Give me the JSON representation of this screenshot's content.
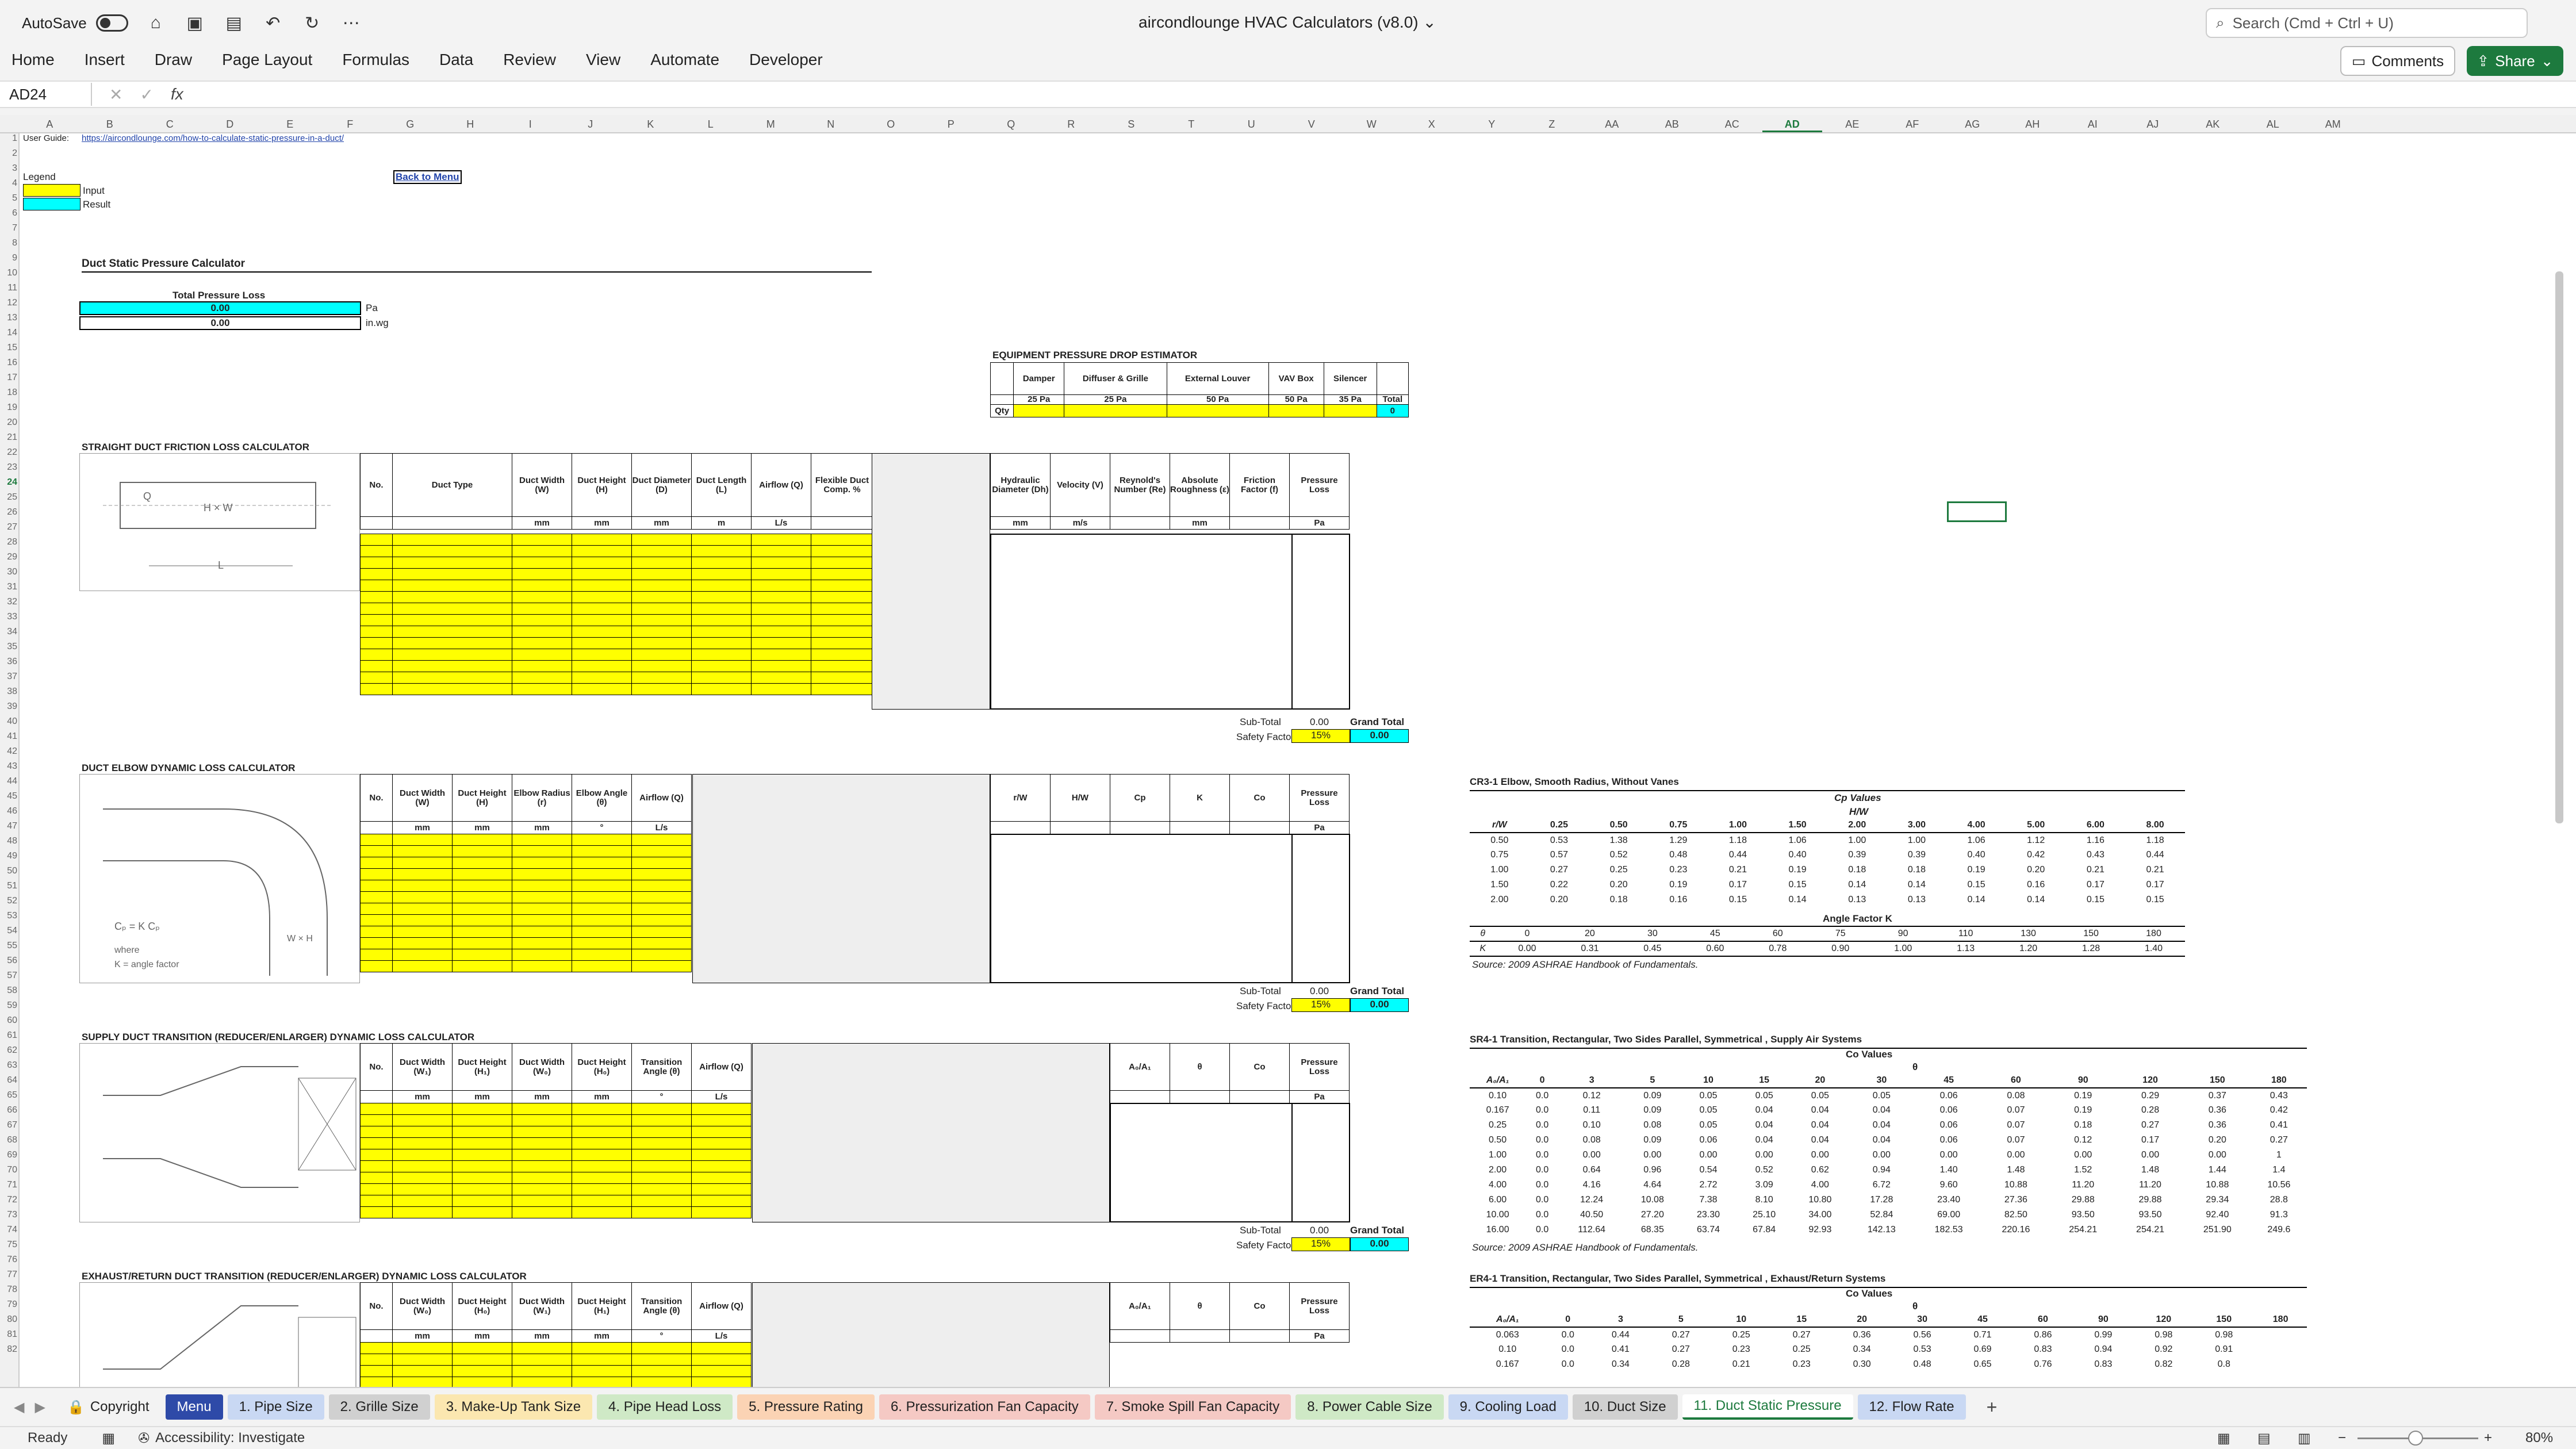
{
  "app": {
    "autosave": "AutoSave",
    "title": "aircondlounge HVAC Calculators (v8.0)",
    "search_placeholder": "Search (Cmd + Ctrl + U)"
  },
  "ribbon": {
    "tabs": [
      "Home",
      "Insert",
      "Draw",
      "Page Layout",
      "Formulas",
      "Data",
      "Review",
      "View",
      "Automate",
      "Developer"
    ],
    "comments": "Comments",
    "share": "Share"
  },
  "formula": {
    "namebox": "AD24",
    "fx": "fx"
  },
  "columns": [
    "A",
    "B",
    "C",
    "D",
    "E",
    "F",
    "G",
    "H",
    "I",
    "J",
    "K",
    "L",
    "M",
    "N",
    "O",
    "P",
    "Q",
    "R",
    "S",
    "T",
    "U",
    "V",
    "W",
    "X",
    "Y",
    "Z",
    "AA",
    "AB",
    "AC",
    "AD",
    "AE",
    "AF",
    "AG",
    "AH",
    "AI",
    "AJ",
    "AK",
    "AL",
    "AM"
  ],
  "sheet": {
    "user_guide_label": "User Guide:",
    "user_guide_url": "https://aircondlounge.com/how-to-calculate-static-pressure-in-a-duct/",
    "legend": "Legend",
    "legend_input": "Input",
    "legend_result": "Result",
    "back_to_menu": "Back to Menu",
    "calc_title": "Duct Static Pressure Calculator",
    "total_loss_label": "Total Pressure Loss",
    "total_pa": "0.00",
    "total_inwg": "0.00",
    "unit_pa": "Pa",
    "unit_inwg": "in.wg",
    "equip": {
      "title": "EQUIPMENT PRESSURE DROP ESTIMATOR",
      "headers": [
        "Damper",
        "Diffuser & Grille",
        "External Louver",
        "VAV Box",
        "Silencer"
      ],
      "values": [
        "25 Pa",
        "25 Pa",
        "50 Pa",
        "50 Pa",
        "35 Pa"
      ],
      "total": "Total",
      "qty": "Qty",
      "total_value": "0"
    },
    "straight": {
      "title": "STRAIGHT DUCT FRICTION LOSS CALCULATOR",
      "headers": [
        "No.",
        "Duct Type",
        "Duct Width (W)",
        "Duct Height (H)",
        "Duct Diameter (D)",
        "Duct Length (L)",
        "Airflow (Q)",
        "Flexible Duct Comp. %"
      ],
      "units": [
        "",
        "",
        "mm",
        "mm",
        "mm",
        "m",
        "L/s",
        ""
      ],
      "right_headers": [
        "Hydraulic Diameter (Dh)",
        "Velocity (V)",
        "Reynold's Number (Re)",
        "Absolute Roughness (ε)",
        "Friction Factor (f)",
        "Pressure Loss"
      ],
      "right_units": [
        "mm",
        "m/s",
        "",
        "mm",
        "",
        "Pa"
      ],
      "subtotal": "0.00",
      "sf": "15%",
      "grand": "0.00"
    },
    "elbow": {
      "title": "DUCT ELBOW DYNAMIC LOSS CALCULATOR",
      "headers": [
        "No.",
        "Duct Width (W)",
        "Duct Height (H)",
        "Elbow Radius (r)",
        "Elbow Angle (θ)",
        "Airflow (Q)"
      ],
      "units": [
        "",
        "mm",
        "mm",
        "mm",
        "°",
        "L/s"
      ],
      "right_headers": [
        "r/W",
        "H/W",
        "Cp",
        "K",
        "Co",
        "Pressure Loss"
      ],
      "right_units": [
        "",
        "",
        "",
        "",
        "",
        "Pa"
      ],
      "subtotal": "0.00",
      "sf": "15%",
      "grand": "0.00"
    },
    "supply": {
      "title": "SUPPLY DUCT TRANSITION (REDUCER/ENLARGER) DYNAMIC LOSS CALCULATOR",
      "headers": [
        "No.",
        "Duct Width (W₁)",
        "Duct Height (H₁)",
        "Duct Width (W₀)",
        "Duct Height (H₀)",
        "Transition Angle (θ)",
        "Airflow (Q)"
      ],
      "units": [
        "",
        "mm",
        "mm",
        "mm",
        "mm",
        "°",
        "L/s"
      ],
      "right_headers": [
        "A₀/A₁",
        "θ",
        "Co",
        "Pressure Loss"
      ],
      "right_units": [
        "",
        "",
        "",
        "Pa"
      ],
      "subtotal": "0.00",
      "sf": "15%",
      "grand": "0.00"
    },
    "exhaust": {
      "title": "EXHAUST/RETURN DUCT TRANSITION (REDUCER/ENLARGER) DYNAMIC LOSS CALCULATOR",
      "headers": [
        "No.",
        "Duct Width (W₀)",
        "Duct Height (H₀)",
        "Duct Width (W₁)",
        "Duct Height (H₁)",
        "Transition Angle (θ)",
        "Airflow (Q)"
      ],
      "units": [
        "",
        "mm",
        "mm",
        "mm",
        "mm",
        "°",
        "L/s"
      ],
      "right_headers": [
        "A₀/A₁",
        "θ",
        "Co",
        "Pressure Loss"
      ],
      "right_units": [
        "",
        "",
        "",
        "Pa"
      ]
    },
    "subtotal_label": "Sub-Total",
    "grand_label": "Grand Total",
    "sf_label": "Safety Factor",
    "diagram_labels": {
      "straight_q": "Q",
      "straight_hw": "H × W",
      "straight_l": "L",
      "elbow_eq": "Cₚ = K Cₚ",
      "elbow_where": "where",
      "elbow_k": "K = angle factor",
      "elbow_wh": "W × H"
    },
    "cr3": {
      "title": "CR3-1 Elbow, Smooth Radius, Without Vanes",
      "cp": "Cp Values",
      "hw": "H/W",
      "rw": "r/W",
      "cols": [
        "0.25",
        "0.50",
        "0.75",
        "1.00",
        "1.50",
        "2.00",
        "3.00",
        "4.00",
        "5.00",
        "6.00",
        "8.00"
      ],
      "rows": [
        [
          "0.50",
          "0.53",
          "1.38",
          "1.29",
          "1.18",
          "1.06",
          "1.00",
          "1.00",
          "1.06",
          "1.12",
          "1.16",
          "1.18"
        ],
        [
          "0.75",
          "0.57",
          "0.52",
          "0.48",
          "0.44",
          "0.40",
          "0.39",
          "0.39",
          "0.40",
          "0.42",
          "0.43",
          "0.44"
        ],
        [
          "1.00",
          "0.27",
          "0.25",
          "0.23",
          "0.21",
          "0.19",
          "0.18",
          "0.18",
          "0.19",
          "0.20",
          "0.21",
          "0.21"
        ],
        [
          "1.50",
          "0.22",
          "0.20",
          "0.19",
          "0.17",
          "0.15",
          "0.14",
          "0.14",
          "0.15",
          "0.16",
          "0.17",
          "0.17"
        ],
        [
          "2.00",
          "0.20",
          "0.18",
          "0.16",
          "0.15",
          "0.14",
          "0.13",
          "0.13",
          "0.14",
          "0.14",
          "0.15",
          "0.15"
        ]
      ],
      "af": "Angle Factor K",
      "theta": [
        "θ",
        "0",
        "20",
        "30",
        "45",
        "60",
        "75",
        "90",
        "110",
        "130",
        "150",
        "180"
      ],
      "k": [
        "K",
        "0.00",
        "0.31",
        "0.45",
        "0.60",
        "0.78",
        "0.90",
        "1.00",
        "1.13",
        "1.20",
        "1.28",
        "1.40"
      ],
      "source": "Source: 2009 ASHRAE Handbook of Fundamentals."
    },
    "sr4": {
      "title": "SR4-1 Transition, Rectangular, Two Sides Parallel, Symmetrical , Supply Air Systems",
      "co": "Co Values",
      "th": "θ",
      "a": "A₀/A₁",
      "cols": [
        "0",
        "3",
        "5",
        "10",
        "15",
        "20",
        "30",
        "45",
        "60",
        "90",
        "120",
        "150",
        "180"
      ],
      "rows": [
        [
          "0.10",
          "0.0",
          "0.12",
          "0.09",
          "0.05",
          "0.05",
          "0.05",
          "0.05",
          "0.06",
          "0.08",
          "0.19",
          "0.29",
          "0.37",
          "0.43"
        ],
        [
          "0.167",
          "0.0",
          "0.11",
          "0.09",
          "0.05",
          "0.04",
          "0.04",
          "0.04",
          "0.06",
          "0.07",
          "0.19",
          "0.28",
          "0.36",
          "0.42"
        ],
        [
          "0.25",
          "0.0",
          "0.10",
          "0.08",
          "0.05",
          "0.04",
          "0.04",
          "0.04",
          "0.06",
          "0.07",
          "0.18",
          "0.27",
          "0.36",
          "0.41"
        ],
        [
          "0.50",
          "0.0",
          "0.08",
          "0.09",
          "0.06",
          "0.04",
          "0.04",
          "0.04",
          "0.06",
          "0.07",
          "0.12",
          "0.17",
          "0.20",
          "0.27"
        ],
        [
          "1.00",
          "0.0",
          "0.00",
          "0.00",
          "0.00",
          "0.00",
          "0.00",
          "0.00",
          "0.00",
          "0.00",
          "0.00",
          "0.00",
          "0.00",
          "1"
        ],
        [
          "2.00",
          "0.0",
          "0.64",
          "0.96",
          "0.54",
          "0.52",
          "0.62",
          "0.94",
          "1.40",
          "1.48",
          "1.52",
          "1.48",
          "1.44",
          "1.4"
        ],
        [
          "4.00",
          "0.0",
          "4.16",
          "4.64",
          "2.72",
          "3.09",
          "4.00",
          "6.72",
          "9.60",
          "10.88",
          "11.20",
          "11.20",
          "10.88",
          "10.56"
        ],
        [
          "6.00",
          "0.0",
          "12.24",
          "10.08",
          "7.38",
          "8.10",
          "10.80",
          "17.28",
          "23.40",
          "27.36",
          "29.88",
          "29.88",
          "29.34",
          "28.8"
        ],
        [
          "10.00",
          "0.0",
          "40.50",
          "27.20",
          "23.30",
          "25.10",
          "34.00",
          "52.84",
          "69.00",
          "82.50",
          "93.50",
          "93.50",
          "92.40",
          "91.3"
        ],
        [
          "16.00",
          "0.0",
          "112.64",
          "68.35",
          "63.74",
          "67.84",
          "92.93",
          "142.13",
          "182.53",
          "220.16",
          "254.21",
          "254.21",
          "251.90",
          "249.6"
        ]
      ],
      "source": "Source: 2009 ASHRAE Handbook of Fundamentals."
    },
    "er4": {
      "title": "ER4-1 Transition, Rectangular, Two Sides Parallel, Symmetrical , Exhaust/Return Systems",
      "co": "Co Values",
      "th": "θ",
      "a": "A₀/A₁",
      "cols": [
        "0",
        "3",
        "5",
        "10",
        "15",
        "20",
        "30",
        "45",
        "60",
        "90",
        "120",
        "150",
        "180"
      ],
      "rows": [
        [
          "0.063",
          "0.0",
          "0.44",
          "0.27",
          "0.25",
          "0.27",
          "0.36",
          "0.56",
          "0.71",
          "0.86",
          "0.99",
          "0.98",
          "0.98"
        ],
        [
          "0.10",
          "0.0",
          "0.41",
          "0.27",
          "0.23",
          "0.25",
          "0.34",
          "0.53",
          "0.69",
          "0.83",
          "0.94",
          "0.92",
          "0.91"
        ],
        [
          "0.167",
          "0.0",
          "0.34",
          "0.28",
          "0.21",
          "0.23",
          "0.30",
          "0.48",
          "0.65",
          "0.76",
          "0.83",
          "0.82",
          "0.8"
        ]
      ]
    }
  },
  "sheet_tabs": [
    {
      "label": "Copyright",
      "color": "#f3f3f3"
    },
    {
      "label": "Menu",
      "color": "#2e4aa8"
    },
    {
      "label": "1. Pipe Size",
      "color": "#c9d8f3"
    },
    {
      "label": "2. Grille Size",
      "color": "#d0d0d0"
    },
    {
      "label": "3. Make-Up Tank Size",
      "color": "#fbe7b0"
    },
    {
      "label": "4. Pipe Head Loss",
      "color": "#cfe9c6"
    },
    {
      "label": "5. Pressure Rating",
      "color": "#fbd3b4"
    },
    {
      "label": "6. Pressurization Fan Capacity",
      "color": "#f5c9c4"
    },
    {
      "label": "7. Smoke Spill Fan Capacity",
      "color": "#f5c9c4"
    },
    {
      "label": "8. Power Cable Size",
      "color": "#cfe9c6"
    },
    {
      "label": "9. Cooling Load",
      "color": "#c9d8f3"
    },
    {
      "label": "10. Duct Size",
      "color": "#d0d0d0"
    },
    {
      "label": "11. Duct Static Pressure",
      "color": "#ffffff"
    },
    {
      "label": "12. Flow Rate",
      "color": "#c9d8f3"
    }
  ],
  "status": {
    "ready": "Ready",
    "accessibility": "Accessibility: Investigate",
    "zoom": "80%"
  }
}
